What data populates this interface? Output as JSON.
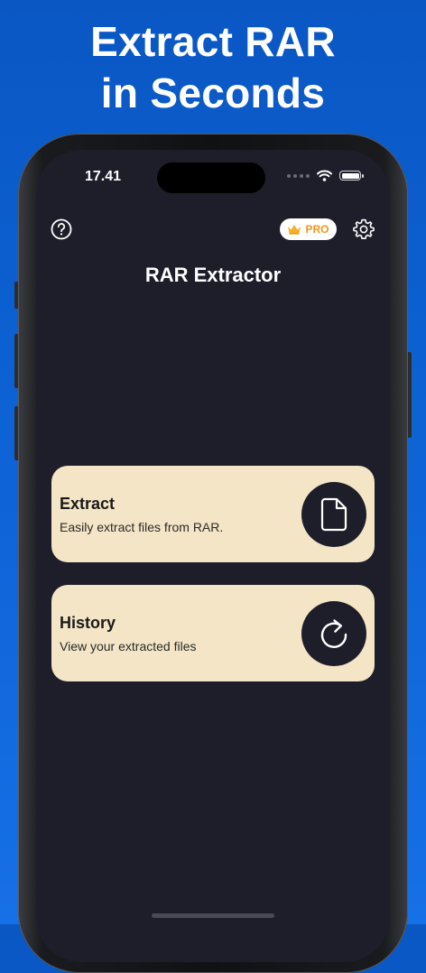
{
  "headline": {
    "line1": "Extract RAR",
    "line2": "in Seconds"
  },
  "status_bar": {
    "time": "17.41"
  },
  "header": {
    "help_icon": "question-circle-icon",
    "pro_label": "PRO",
    "pro_icon": "crown-icon",
    "settings_icon": "gear-icon"
  },
  "app": {
    "title": "RAR Extractor"
  },
  "cards": [
    {
      "title": "Extract",
      "subtitle": "Easily extract files from RAR.",
      "icon": "document-icon"
    },
    {
      "title": "History",
      "subtitle": "View your extracted files",
      "icon": "refresh-icon"
    }
  ],
  "colors": {
    "background_top": "#0a57c4",
    "screen_bg": "#1e1d2a",
    "card_bg": "#f4e5c6",
    "pro_text": "#f2941e",
    "crown": "#f5b12e"
  }
}
